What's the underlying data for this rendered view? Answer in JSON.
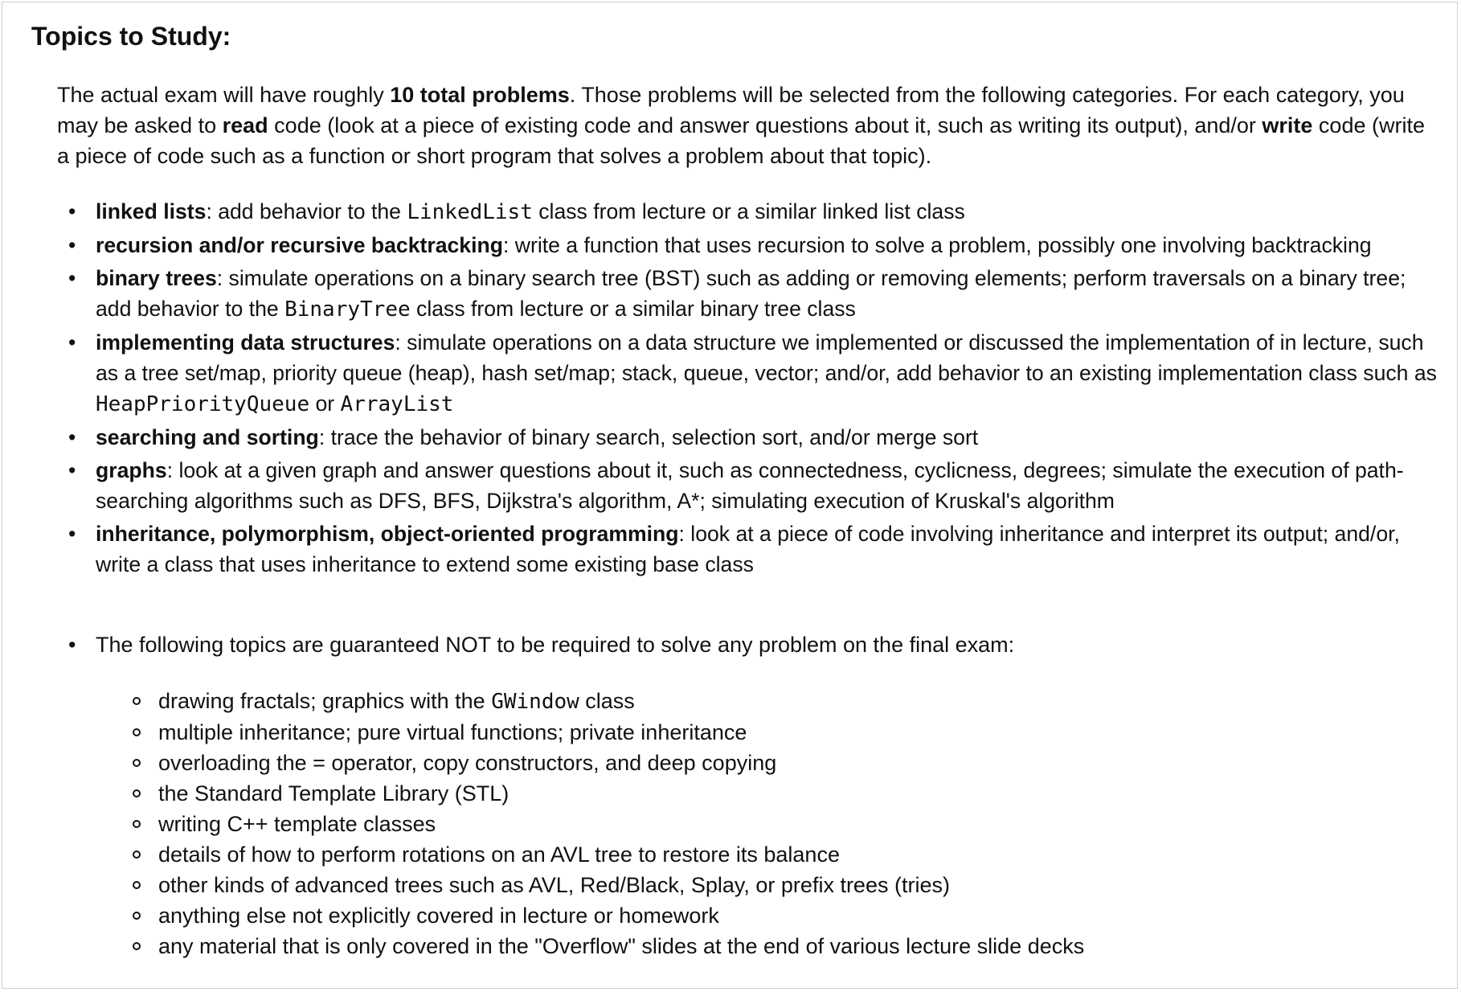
{
  "title": "Topics to Study:",
  "intro": {
    "part1": "The actual exam will have roughly ",
    "bold1": "10 total problems",
    "part2": ". Those problems will be selected from the following categories. For each category, you may be asked to ",
    "bold2": "read",
    "part3": " code (look at a piece of existing code and answer questions about it, such as writing its output), and/or ",
    "bold3": "write",
    "part4": " code (write a piece of code such as a function or short program that solves a problem about that topic)."
  },
  "bullet_glyph": "•",
  "topics": [
    {
      "name": "linked lists",
      "text1": ": add behavior to the ",
      "code1": "LinkedList",
      "text2": " class from lecture or a similar linked list class"
    },
    {
      "name": "recursion and/or recursive backtracking",
      "text1": ": write a function that uses recursion to solve a problem, possibly one involving backtracking"
    },
    {
      "name": "binary trees",
      "text1": ": simulate operations on a binary search tree (BST) such as adding or removing elements; perform traversals on a binary tree; add behavior to the ",
      "code1": "BinaryTree",
      "text2": " class from lecture or a similar binary tree class"
    },
    {
      "name": "implementing data structures",
      "text1": ": simulate operations on a data structure we implemented or discussed the implementation of in lecture, such as a tree set/map, priority queue (heap), hash set/map; stack, queue, vector; and/or, add behavior to an existing implementation class such as ",
      "code1": "HeapPriorityQueue",
      "text2": " or ",
      "code2": "ArrayList"
    },
    {
      "name": "searching and sorting",
      "text1": ": trace the behavior of binary search, selection sort, and/or merge sort"
    },
    {
      "name": "graphs",
      "text1": ": look at a given graph and answer questions about it, such as connectedness, cyclicness, degrees; simulate the execution of path-searching algorithms such as DFS, BFS, Dijkstra's algorithm, A*; simulating execution of Kruskal's algorithm"
    },
    {
      "name": "inheritance, polymorphism, object-oriented programming",
      "text1": ": look at a piece of code involving inheritance and interpret its output; and/or, write a class that uses inheritance to extend some existing base class"
    }
  ],
  "not_required": {
    "heading": "The following topics are guaranteed NOT to be required to solve any problem on the final exam:",
    "items": [
      {
        "text1": "drawing fractals; graphics with the ",
        "code1": "GWindow",
        "text2": " class"
      },
      {
        "text1": "multiple inheritance; pure virtual functions; private inheritance"
      },
      {
        "text1": "overloading the = operator, copy constructors, and deep copying"
      },
      {
        "text1": "the Standard Template Library (STL)"
      },
      {
        "text1": "writing C++ template classes"
      },
      {
        "text1": "details of how to perform rotations on an AVL tree to restore its balance"
      },
      {
        "text1": "other kinds of advanced trees such as AVL, Red/Black, Splay, or prefix trees (tries)"
      },
      {
        "text1": "anything else not explicitly covered in lecture or homework"
      },
      {
        "text1": "any material that is only covered in the \"Overflow\" slides at the end of various lecture slide decks"
      }
    ]
  }
}
